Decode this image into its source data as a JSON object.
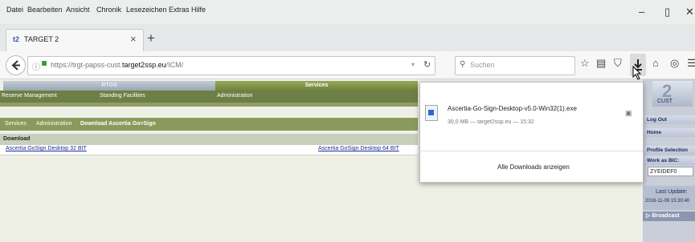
{
  "menu": [
    "Datei",
    "Bearbeiten",
    "Ansicht",
    "Chronik",
    "Lesezeichen",
    "Extras",
    "Hilfe"
  ],
  "window_buttons": {
    "minimize": "–",
    "maximize": "▯",
    "close": "✕"
  },
  "tab": {
    "icon": "t2",
    "title": "TARGET 2",
    "close": "×",
    "new_tab": "+"
  },
  "url": {
    "prefix": "https://trgt-papss-cust.",
    "host": "target2ssp.eu",
    "path": "/ICM/"
  },
  "search": {
    "placeholder": "Suchen"
  },
  "nav_tabs": {
    "rtgs": "RTGS",
    "services": "Services"
  },
  "subnav": [
    "Reserve Management",
    "Standing Facilities",
    "Administration"
  ],
  "subnav2": [
    "Services",
    "Administration",
    "Download Ascertia Go>Sign"
  ],
  "download": {
    "header": "Download",
    "link32": "Ascertia GoSign Desktop 32 BIT",
    "link64": "Ascertia GoSign Desktop 64 BIT"
  },
  "popup": {
    "filename": "Ascertia-Go-Sign-Desktop-v5.0-Win32(1).exe",
    "meta": "30,0 MB — target2ssp.eu — 15:32",
    "show_all": "Alle Downloads anzeigen"
  },
  "sidebar": {
    "user": "CUST",
    "items": [
      "Log Out",
      "Home",
      "Profile Selection",
      "Work as BIC:",
      "ZYEIDEF0"
    ],
    "last_update_label": "Last Update:",
    "last_update_value": "2016-11-09 15:30:40",
    "broadcast": "Broadcast"
  },
  "colors": {
    "services_green": "#6e833a",
    "link_blue": "#1a2a9a",
    "sidebar_blue": "#c9ced8"
  }
}
